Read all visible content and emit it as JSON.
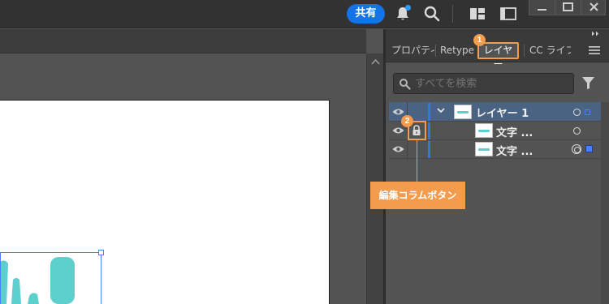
{
  "topbar": {
    "share_label": "共有",
    "icons": [
      "bell-icon",
      "search-icon",
      "arrange-documents-icon",
      "screen-mode-icon"
    ],
    "window_controls": [
      "minimize-icon",
      "maximize-icon",
      "close-icon"
    ]
  },
  "panel": {
    "tabs": [
      {
        "label": "プロパティ"
      },
      {
        "label": "Retype"
      },
      {
        "label": "レイヤー"
      },
      {
        "label": "CC ライブラリ"
      }
    ],
    "active_tab_index": 2,
    "search_placeholder": "すべてを検索",
    "layers": [
      {
        "name": "レイヤー 1",
        "expanded": true,
        "selected": true
      },
      {
        "name": "文字 ...",
        "locked": true
      },
      {
        "name": "文字 ..."
      }
    ]
  },
  "annotations": {
    "badge_1": "1",
    "badge_2": "2",
    "callout": "編集コラムボタン"
  },
  "colors": {
    "accent": "#f39c4d",
    "share": "#1473e6",
    "selection": "#4a7fff",
    "row_selected": "#4b6382",
    "artwork": "#5dd0ce"
  }
}
